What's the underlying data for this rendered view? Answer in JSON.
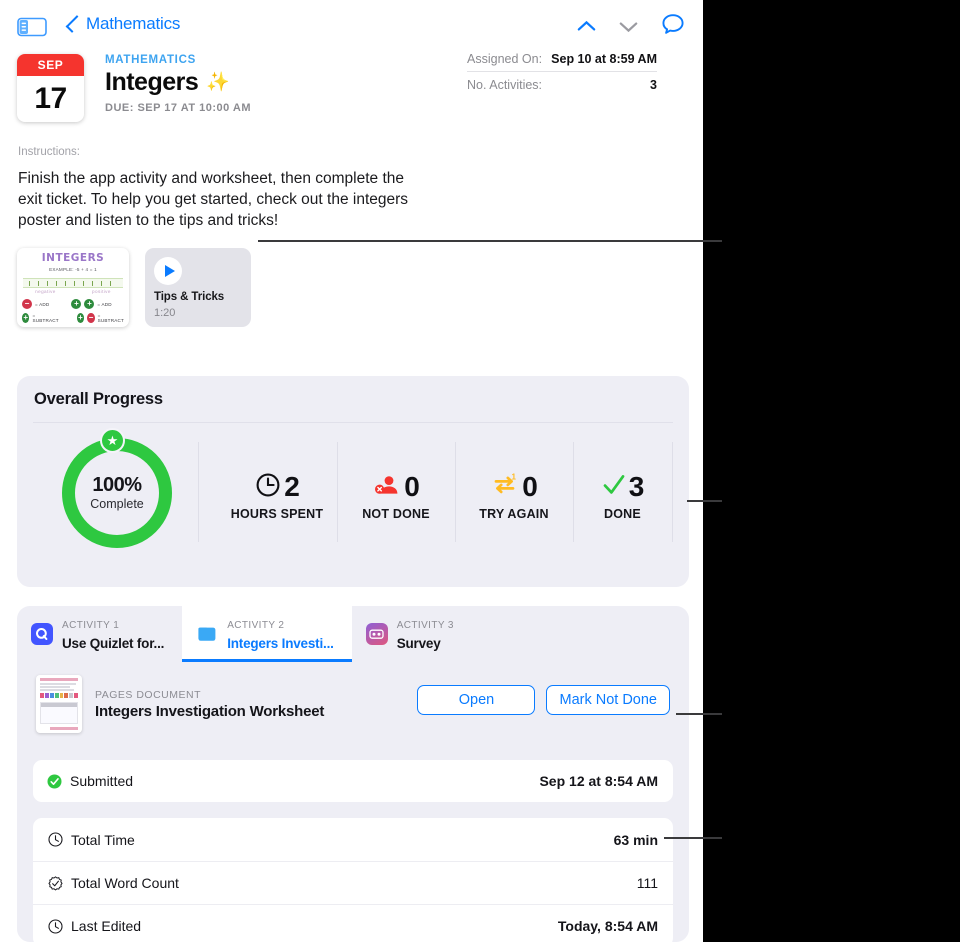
{
  "navbar": {
    "sidebar_toggle_icon": "sidebar-icon",
    "back_label": "Mathematics",
    "prev_icon": "chevron-up-icon",
    "next_icon": "chevron-down-icon",
    "comments_icon": "comment-bubble-icon",
    "accent_color": "#0a7bff"
  },
  "assignment": {
    "date_badge": {
      "month": "SEP",
      "day": "17",
      "header_color": "#f5342e"
    },
    "subject": "MATHEMATICS",
    "title": "Integers",
    "title_emoji": "✨",
    "due": "DUE: SEP 17 AT 10:00 AM",
    "meta": [
      {
        "key": "Assigned On:",
        "value": "Sep 10 at 8:59 AM"
      },
      {
        "key": "No. Activities:",
        "value": "3"
      }
    ]
  },
  "instructions": {
    "label": "Instructions:",
    "body": "Finish the app activity and worksheet, then complete the exit ticket. To help you get started, check out the integers poster and listen to the tips and tricks!"
  },
  "attachments": {
    "poster": {
      "name": "integers-poster-thumbnail",
      "heading": "INTEGERS",
      "subheading": "EXAMPLE: -5 + 4 = 1",
      "negative_label": "negative",
      "positive_label": "positive",
      "rules": [
        {
          "left": "−",
          "right": "",
          "text": "= ADD"
        },
        {
          "left": "+",
          "right": "",
          "text": "= SUBTRACT"
        },
        {
          "left": "+",
          "right": "+",
          "text": "= ADD"
        },
        {
          "left": "+",
          "right": "−",
          "text": "= SUBTRACT"
        }
      ]
    },
    "video": {
      "name": "tips-and-tricks-video",
      "play_icon": "play-icon",
      "title": "Tips & Tricks",
      "duration": "1:20"
    }
  },
  "progress": {
    "heading": "Overall Progress",
    "ring": {
      "percent": "100%",
      "sub": "Complete",
      "color": "#2ec840",
      "badge_icon": "star-icon"
    },
    "stats": [
      {
        "icon": "clock-icon",
        "value": "2",
        "label": "HOURS SPENT",
        "color": "#101014"
      },
      {
        "icon": "person-not-done-icon",
        "value": "0",
        "label": "NOT DONE",
        "color": "#f5342e"
      },
      {
        "icon": "try-again-arrows-icon",
        "value": "0",
        "label": "TRY AGAIN",
        "color": "#ffbb22"
      },
      {
        "icon": "checkmark-icon",
        "value": "3",
        "label": "DONE",
        "color": "#2ec840"
      }
    ]
  },
  "activities": {
    "tabs": [
      {
        "kicker": "ACTIVITY 1",
        "name": "Use Quizlet for...",
        "icon": "quizlet-app-icon",
        "active": false
      },
      {
        "kicker": "ACTIVITY 2",
        "name": "Integers Investi...",
        "icon": "pages-document-icon",
        "active": true
      },
      {
        "kicker": "ACTIVITY 3",
        "name": "Survey",
        "icon": "survey-app-icon",
        "active": false
      }
    ],
    "document": {
      "thumbnail_name": "worksheet-thumbnail",
      "kicker": "PAGES DOCUMENT",
      "title": "Integers Investigation Worksheet",
      "buttons": [
        {
          "label": "Open",
          "name": "open-button"
        },
        {
          "label": "Mark Not Done",
          "name": "mark-not-done-button"
        }
      ]
    },
    "submission": {
      "icon": "checkmark-circle-icon",
      "label": "Submitted",
      "date": "Sep 12 at 8:54 AM"
    },
    "stats": [
      {
        "icon": "clock-icon",
        "label": "Total Time",
        "value": "63 min",
        "bold": true
      },
      {
        "icon": "word-count-icon",
        "label": "Total Word Count",
        "value": "111",
        "bold": false
      },
      {
        "icon": "clock-icon",
        "label": "Last Edited",
        "value": "Today, 8:54 AM",
        "bold": true
      }
    ]
  }
}
